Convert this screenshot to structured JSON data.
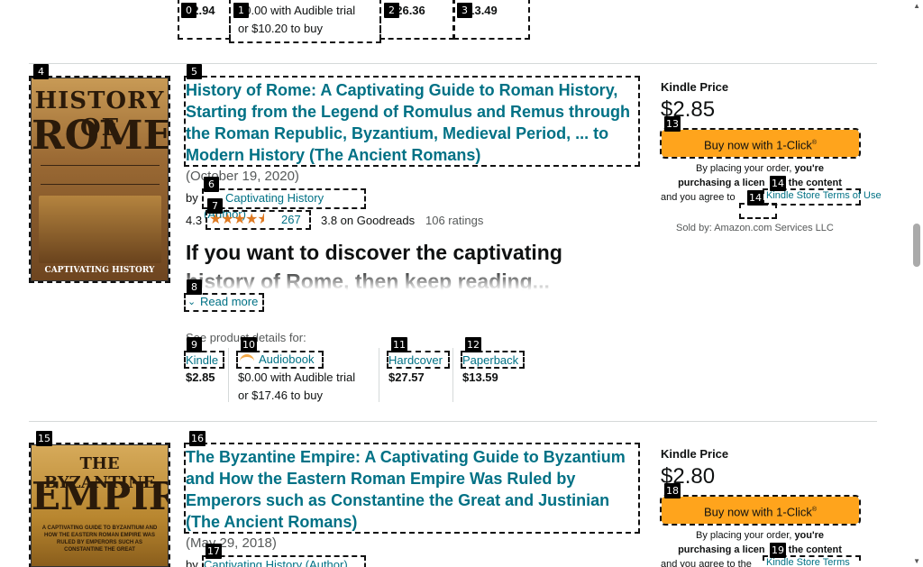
{
  "top_formats": {
    "kindle_price": "$2.94",
    "audiobook_price": "$0.00 with Audible trial",
    "audiobook_buy": "or $10.20 to buy",
    "hardcover_price": "$26.36",
    "paperback_price": "$13.49"
  },
  "book1": {
    "title": "History of Rome: A Captivating Guide to Roman History, Starting from the Legend of Romulus and Remus through the Roman Republic, Byzantium, Medieval Period, ... to Modern History (The Ancient Romans)",
    "date": "(October 19, 2020)",
    "by": "by",
    "author": "Captivating History (Author)",
    "rating_value": "4.3",
    "rating_stars": 4.3,
    "rating_count": "267",
    "goodreads": "3.8 on Goodreads",
    "goodreads_ratings": "106 ratings",
    "blurb": "If you want to discover the captivating history of Rome, then keep reading...",
    "read_more": "Read more",
    "see_details": "See product details for:",
    "formats": {
      "kindle_label": "Kindle",
      "kindle_price": "$2.85",
      "audiobook_label": "Audiobook",
      "audiobook_price": "$0.00 with Audible trial",
      "audiobook_buy": "or $17.46 to buy",
      "hardcover_label": "Hardcover",
      "hardcover_price": "$27.57",
      "paperback_label": "Paperback",
      "paperback_price": "$13.59"
    },
    "kindle_price_label": "Kindle Price",
    "kindle_price_big": "$2.85",
    "buy_button": "Buy now with 1-Click",
    "terms_line1": "By placing your order,",
    "terms_bold1": "you're",
    "terms_line2a": "purchasing a licen",
    "terms_line2b": "the content",
    "terms_line3": "and you agree to",
    "terms_link": "Kindle Store Terms of Use",
    "sold_by": "Sold by: Amazon.com Services LLC",
    "cover": {
      "title_line1": "HISTORY OF",
      "title_line2": "ROME",
      "publisher": "CAPTIVATING HISTORY"
    }
  },
  "book2": {
    "title": "The Byzantine Empire: A Captivating Guide to Byzantium and How the Eastern Roman Empire Was Ruled by Emperors such as Constantine the Great and Justinian (The Ancient Romans)",
    "date": "(May 29, 2018)",
    "by": "by",
    "author": "Captivating History (Author)",
    "kindle_price_label": "Kindle Price",
    "kindle_price_big": "$2.80",
    "buy_button": "Buy now with 1-Click",
    "terms_line1": "By placing your order,",
    "terms_bold1": "you're",
    "terms_line2a": "purchasing a licen",
    "terms_line2b": "the content",
    "terms_line3": "and you agree to the",
    "terms_link": "Kindle Store Terms",
    "cover": {
      "title_line1": "THE BYZANTINE",
      "title_line2": "EMPIRE",
      "subtitle": "A CAPTIVATING GUIDE TO BYZANTIUM AND HOW THE EASTERN ROMAN EMPIRE WAS RULED BY EMPERORS SUCH AS CONSTANTINE THE GREAT"
    }
  },
  "badges": [
    "0",
    "1",
    "2",
    "3",
    "4",
    "5",
    "6",
    "7",
    "8",
    "9",
    "10",
    "11",
    "12",
    "13",
    "14",
    "14",
    "15",
    "16",
    "17",
    "18",
    "19"
  ],
  "colors": {
    "link": "#007185",
    "button": "#ffa41c",
    "star": "#de7921",
    "cover_rome": "#8a5a2b",
    "cover_byz": "#b8862f"
  }
}
